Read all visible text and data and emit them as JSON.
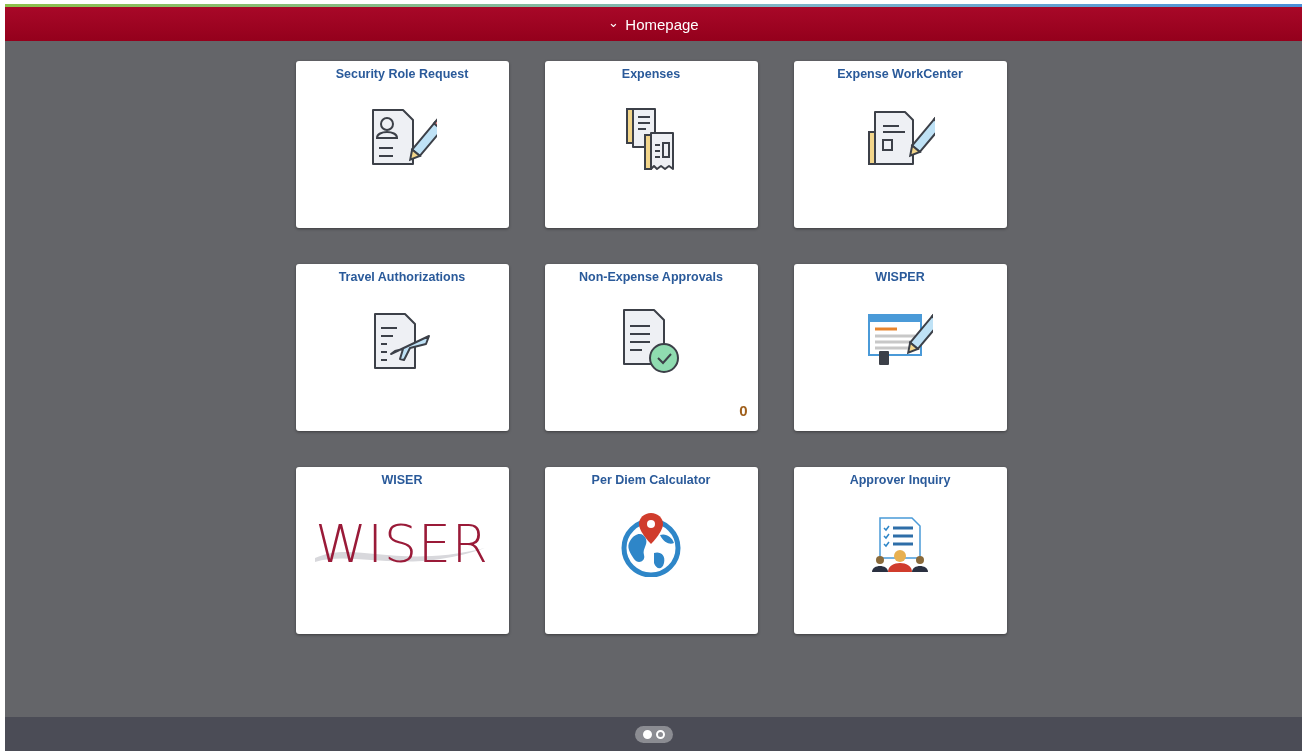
{
  "header": {
    "arrow": "⌄",
    "title": "Homepage"
  },
  "tiles": [
    {
      "title": "Security Role Request",
      "kind": "person-form"
    },
    {
      "title": "Expenses",
      "kind": "receipts"
    },
    {
      "title": "Expense WorkCenter",
      "kind": "edit-form"
    },
    {
      "title": "Travel Authorizations",
      "kind": "travel-form"
    },
    {
      "title": "Non-Expense Approvals",
      "kind": "approved-form",
      "count": "0"
    },
    {
      "title": "WISPER",
      "kind": "web-form"
    },
    {
      "title": "WISER",
      "kind": "logo",
      "logo_text": "WISER"
    },
    {
      "title": "Per Diem Calculator",
      "kind": "globe"
    },
    {
      "title": "Approver Inquiry",
      "kind": "team-list"
    }
  ],
  "pager": [
    {
      "selected": true
    },
    {
      "selected": false
    }
  ]
}
